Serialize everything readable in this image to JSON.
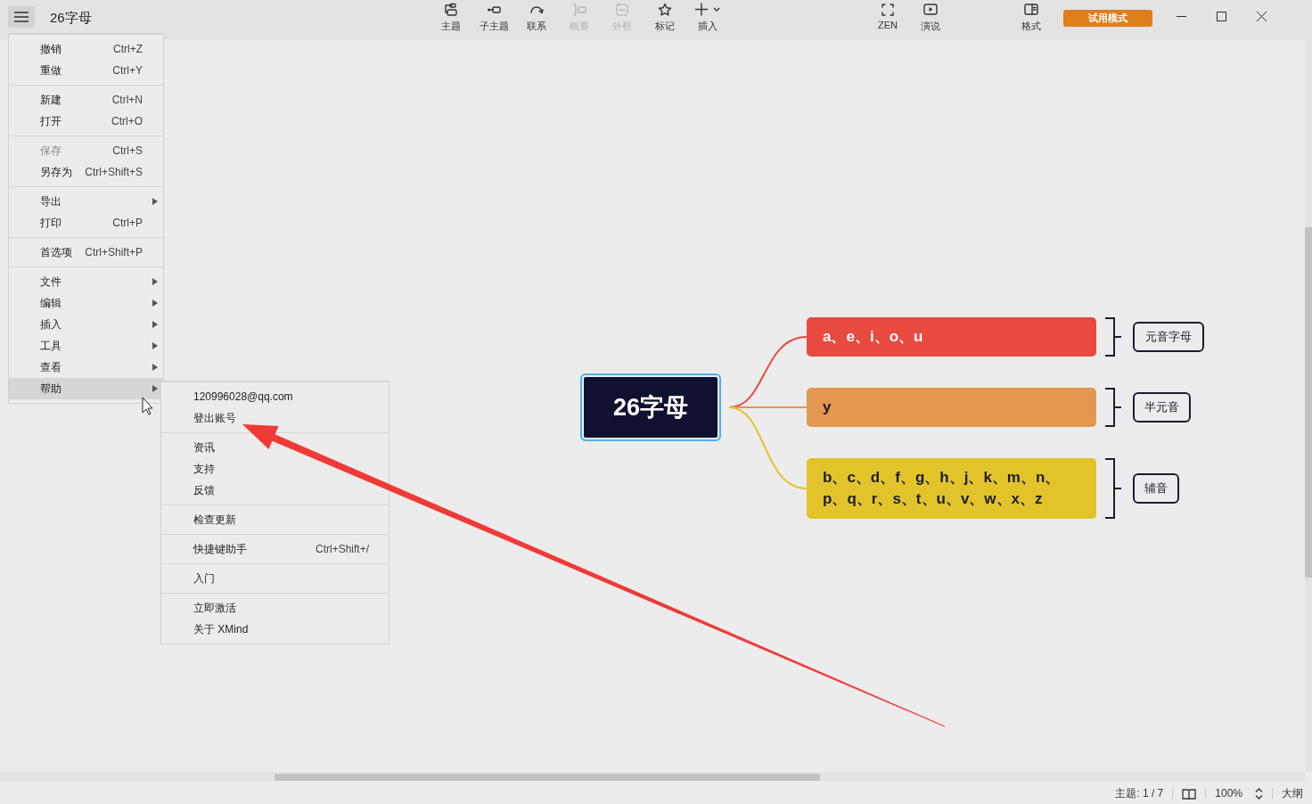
{
  "window": {
    "title": "26字母"
  },
  "toolbar": [
    {
      "kind": "topic",
      "label": "主题",
      "disabled": false
    },
    {
      "kind": "subtopic",
      "label": "子主题",
      "disabled": false
    },
    {
      "kind": "relationship",
      "label": "联系",
      "disabled": false
    },
    {
      "kind": "summary",
      "label": "概要",
      "disabled": true
    },
    {
      "kind": "boundary",
      "label": "外框",
      "disabled": true
    },
    {
      "kind": "marker",
      "label": "标记",
      "disabled": false
    },
    {
      "kind": "insert",
      "label": "插入",
      "disabled": false
    }
  ],
  "view_tools": [
    {
      "kind": "zen",
      "label": "ZEN"
    },
    {
      "kind": "pitch",
      "label": "演说"
    }
  ],
  "format_tool": {
    "kind": "format",
    "label": "格式"
  },
  "trial_button": "试用模式",
  "main_menu": [
    [
      {
        "label": "撤销",
        "shortcut": "Ctrl+Z",
        "disabled": false,
        "submenu": false,
        "selected": false
      },
      {
        "label": "重做",
        "shortcut": "Ctrl+Y",
        "disabled": false,
        "submenu": false,
        "selected": false
      }
    ],
    [
      {
        "label": "新建",
        "shortcut": "Ctrl+N",
        "disabled": false,
        "submenu": false,
        "selected": false
      },
      {
        "label": "打开",
        "shortcut": "Ctrl+O",
        "disabled": false,
        "submenu": false,
        "selected": false
      }
    ],
    [
      {
        "label": "保存",
        "shortcut": "Ctrl+S",
        "disabled": true,
        "submenu": false,
        "selected": false
      },
      {
        "label": "另存为",
        "shortcut": "Ctrl+Shift+S",
        "disabled": false,
        "submenu": false,
        "selected": false
      }
    ],
    [
      {
        "label": "导出",
        "disabled": false,
        "submenu": true,
        "selected": false
      },
      {
        "label": "打印",
        "shortcut": "Ctrl+P",
        "disabled": false,
        "submenu": false,
        "selected": false
      }
    ],
    [
      {
        "label": "首选项",
        "shortcut": "Ctrl+Shift+P",
        "disabled": false,
        "submenu": false,
        "selected": false
      }
    ],
    [
      {
        "label": "文件",
        "disabled": false,
        "submenu": true,
        "selected": false
      },
      {
        "label": "编辑",
        "disabled": false,
        "submenu": true,
        "selected": false
      },
      {
        "label": "插入",
        "disabled": false,
        "submenu": true,
        "selected": false
      },
      {
        "label": "工具",
        "disabled": false,
        "submenu": true,
        "selected": false
      },
      {
        "label": "查看",
        "disabled": false,
        "submenu": true,
        "selected": false
      },
      {
        "label": "帮助",
        "disabled": false,
        "submenu": true,
        "selected": true
      }
    ]
  ],
  "help_submenu": [
    [
      {
        "label": "120996028@qq.com",
        "disabled": false,
        "submenu": false,
        "selected": false
      },
      {
        "label": "登出账号",
        "disabled": false,
        "submenu": false,
        "selected": false
      }
    ],
    [
      {
        "label": "资讯",
        "disabled": false,
        "submenu": false,
        "selected": false
      },
      {
        "label": "支持",
        "disabled": false,
        "submenu": false,
        "selected": false
      },
      {
        "label": "反馈",
        "disabled": false,
        "submenu": false,
        "selected": false
      }
    ],
    [
      {
        "label": "检查更新",
        "disabled": false,
        "submenu": false,
        "selected": false
      }
    ],
    [
      {
        "label": "快捷键助手",
        "shortcut": "Ctrl+Shift+/",
        "disabled": false,
        "submenu": false,
        "selected": false
      }
    ],
    [
      {
        "label": "入门",
        "disabled": false,
        "submenu": false,
        "selected": false
      }
    ],
    [
      {
        "label": "立即激活",
        "disabled": false,
        "submenu": false,
        "selected": false
      },
      {
        "label": "关于 XMind",
        "disabled": false,
        "submenu": false,
        "selected": false
      }
    ]
  ],
  "mind_map": {
    "central": {
      "text": "26字母",
      "selected": true
    },
    "branches": [
      {
        "lines": [
          "a、e、i、o、u"
        ],
        "color": "#e84a40",
        "summary": "元音字母"
      },
      {
        "lines": [
          "y"
        ],
        "color": "#e4974f",
        "summary": "半元音"
      },
      {
        "lines": [
          "b、c、d、f、g、h、j、k、m、n、",
          "p、q、r、s、t、u、v、w、x、z"
        ],
        "color": "#e2c42a",
        "summary": "辅音"
      }
    ]
  },
  "status_bar": {
    "topics": "主题: 1 / 7",
    "zoom": "100%",
    "outline": "大纲"
  }
}
